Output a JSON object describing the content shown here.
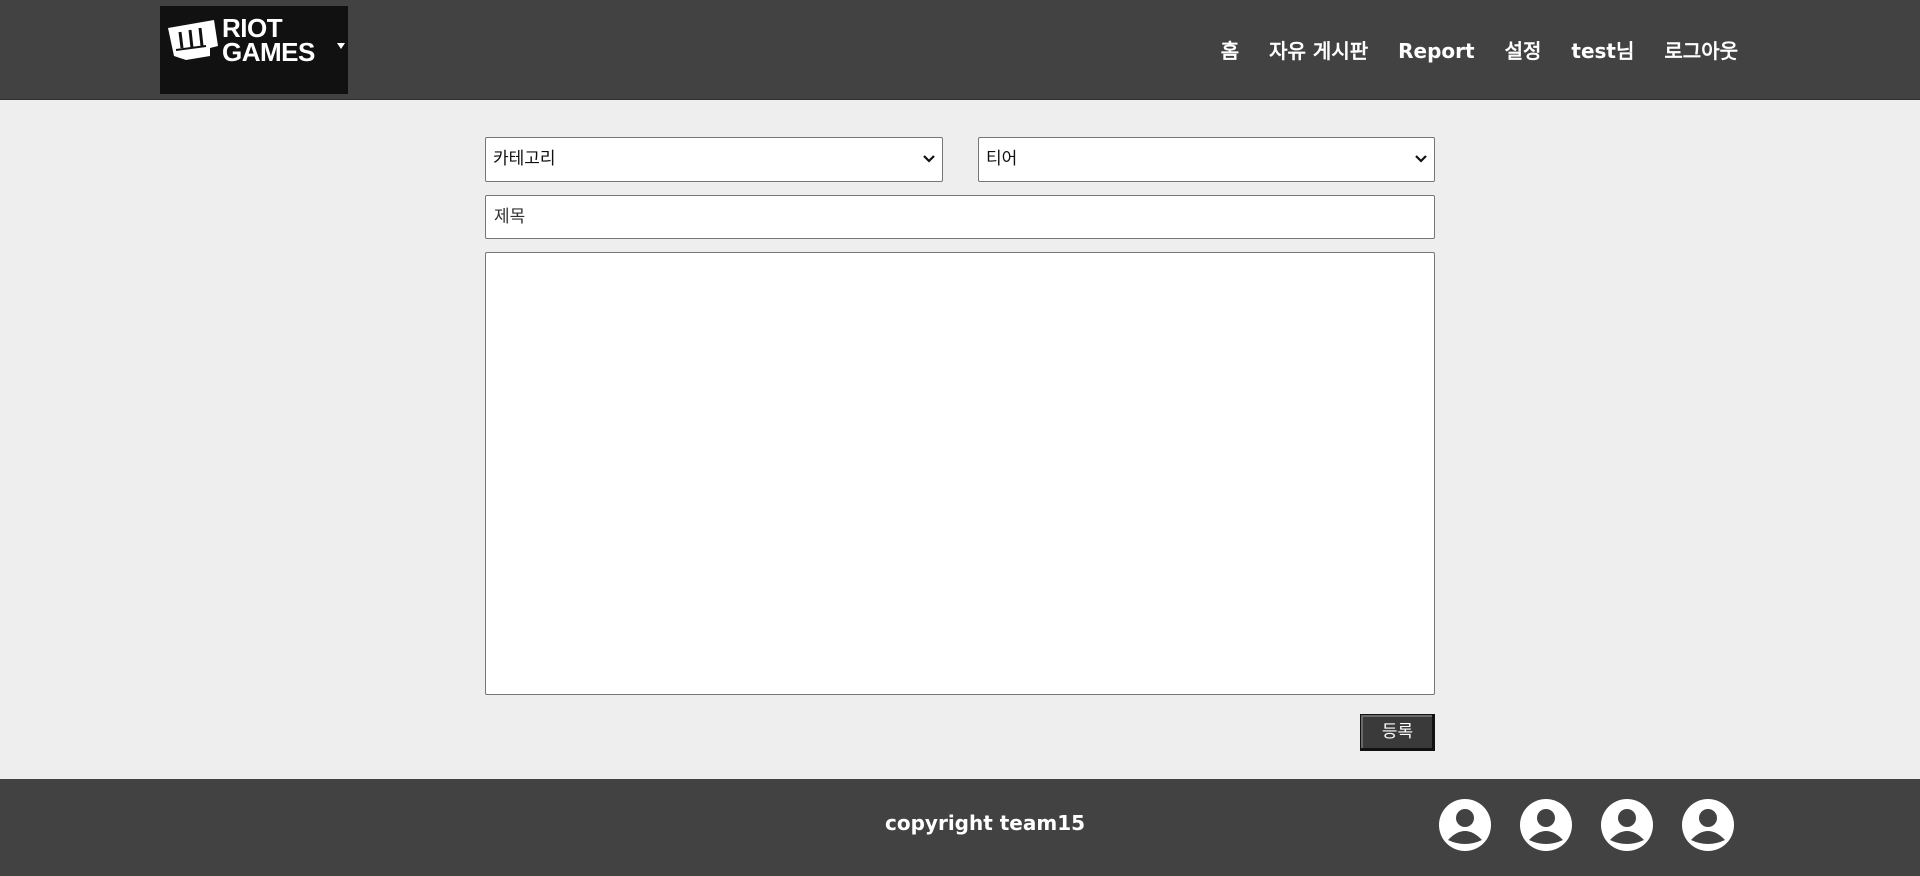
{
  "brand": {
    "logo_text_line1": "RIOT",
    "logo_text_line2": "GAMES",
    "logo_icon": "fist-icon"
  },
  "nav": {
    "items": [
      {
        "label": "홈"
      },
      {
        "label": "자유 게시판"
      },
      {
        "label": "Report"
      },
      {
        "label": "설정"
      },
      {
        "label": "test님"
      },
      {
        "label": "로그아웃"
      }
    ]
  },
  "form": {
    "category_select": {
      "selected": "카테고리"
    },
    "tier_select": {
      "selected": "티어"
    },
    "title_input": {
      "placeholder": "제목",
      "value": ""
    },
    "content_textarea": {
      "value": ""
    },
    "submit_label": "등록"
  },
  "footer": {
    "copyright": "copyright team15",
    "avatars": [
      {
        "icon": "user-avatar-icon"
      },
      {
        "icon": "user-avatar-icon"
      },
      {
        "icon": "user-avatar-icon"
      },
      {
        "icon": "user-avatar-icon"
      }
    ]
  },
  "colors": {
    "header_bg": "#424242",
    "page_bg": "#eeeeee",
    "button_bg": "#3a3a3a"
  }
}
